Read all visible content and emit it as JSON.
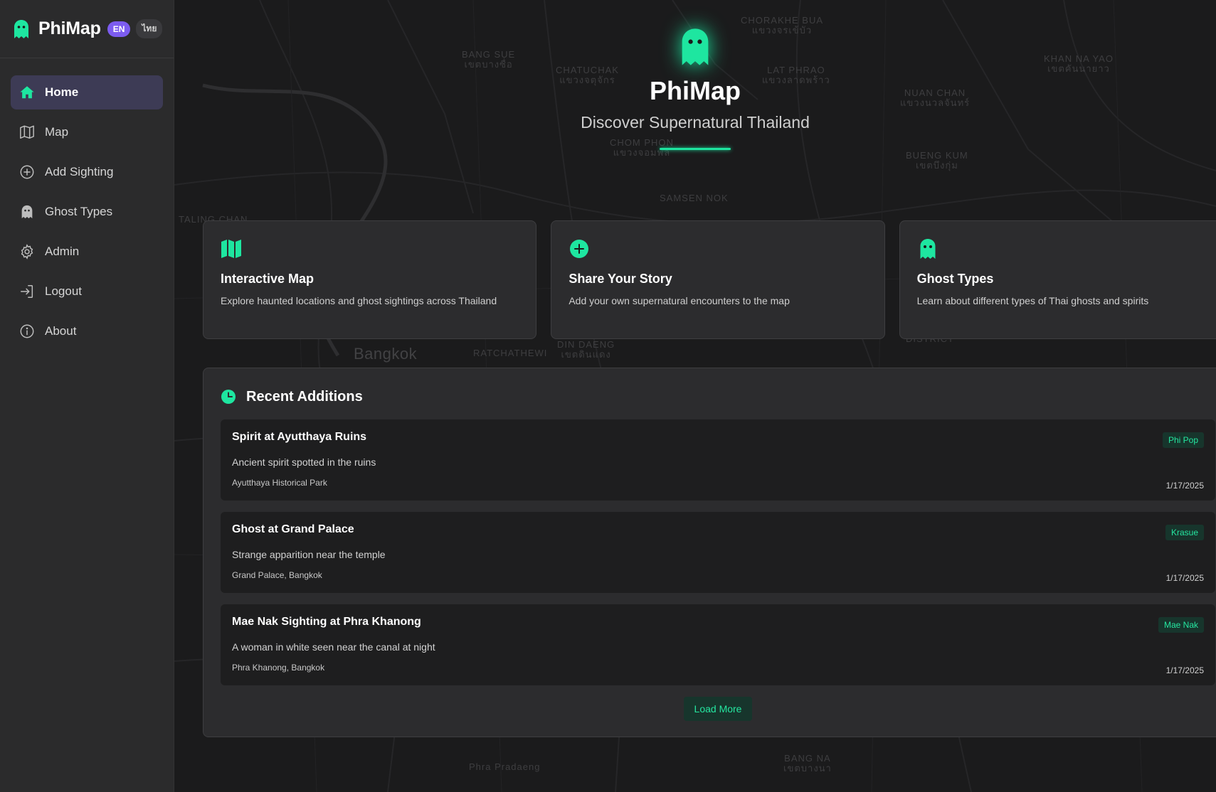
{
  "brand": {
    "title": "PhiMap",
    "lang_en": "EN",
    "lang_th": "ไทย"
  },
  "sidebar": {
    "items": [
      {
        "label": "Home",
        "icon": "home-icon",
        "active": true
      },
      {
        "label": "Map",
        "icon": "map-icon"
      },
      {
        "label": "Add Sighting",
        "icon": "plus-circle-icon"
      },
      {
        "label": "Ghost Types",
        "icon": "ghost-icon"
      },
      {
        "label": "Admin",
        "icon": "gear-icon"
      },
      {
        "label": "Logout",
        "icon": "logout-icon"
      },
      {
        "label": "About",
        "icon": "info-icon"
      }
    ]
  },
  "hero": {
    "title": "PhiMap",
    "subtitle": "Discover Supernatural Thailand"
  },
  "features": [
    {
      "title": "Interactive Map",
      "desc": "Explore haunted locations and ghost sightings across Thailand",
      "icon": "map-icon"
    },
    {
      "title": "Share Your Story",
      "desc": "Add your own supernatural encounters to the map",
      "icon": "plus-circle-icon"
    },
    {
      "title": "Ghost Types",
      "desc": "Learn about different types of Thai ghosts and spirits",
      "icon": "ghost-icon"
    }
  ],
  "recent": {
    "title": "Recent Additions",
    "items": [
      {
        "title": "Spirit at Ayutthaya Ruins",
        "desc": "Ancient spirit spotted in the ruins",
        "location": "Ayutthaya Historical Park",
        "type": "Phi Pop",
        "date": "1/17/2025"
      },
      {
        "title": "Ghost at Grand Palace",
        "desc": "Strange apparition near the temple",
        "location": "Grand Palace, Bangkok",
        "type": "Krasue",
        "date": "1/17/2025"
      },
      {
        "title": "Mae Nak Sighting at Phra Khanong",
        "desc": "A woman in white seen near the canal at night",
        "location": "Phra Khanong, Bangkok",
        "type": "Mae Nak",
        "date": "1/17/2025"
      }
    ],
    "load_more": "Load More"
  },
  "map_labels": [
    "CHORAKHE BUA",
    "แขวงจรเข้บัว",
    "BANG SUE",
    "เขตบางซื่อ",
    "CHATUCHAK",
    "แขวงจตุจักร",
    "LAT PHRAO",
    "แขวงลาดพร้าว",
    "KHAN NA YAO",
    "เขตคันนายาว",
    "NUAN CHAN",
    "แขวงนวลจันทร์",
    "CHOM PHON",
    "แขวงจอมพล",
    "BUENG KUM",
    "เขตบึงกุ่ม",
    "SAMSEN NOK",
    "Bangkok",
    "RATCHATHEWI",
    "DIN DAENG",
    "เขตดินแดง",
    "DISTRICT",
    "Phra Pradaeng",
    "BANG NA",
    "เขตบางนา",
    "TALING CHAN"
  ],
  "colors": {
    "accent": "#1ee6a0",
    "lang_badge": "#7c5cf0",
    "active_nav": "#3d3b55"
  }
}
